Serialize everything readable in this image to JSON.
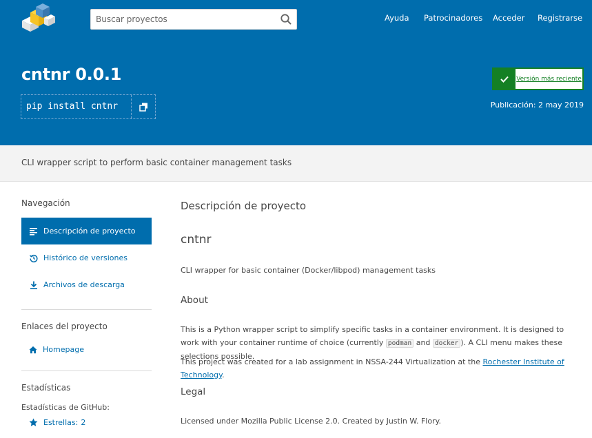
{
  "header": {
    "search_placeholder": "Buscar proyectos",
    "nav": [
      "Ayuda",
      "Patrocinadores",
      "Acceder",
      "Registrarse"
    ]
  },
  "hero": {
    "title": "cntnr 0.0.1",
    "pip_command": "pip install cntnr",
    "latest_version": "Versión más reciente",
    "published": "Publicación: 2 may 2019"
  },
  "summary": "CLI wrapper script to perform basic container management tasks",
  "sidebar": {
    "nav_heading": "Navegación",
    "nav_items": [
      "Descripción de proyecto",
      "Histórico de versiones",
      "Archivos de descarga"
    ],
    "links_heading": "Enlaces del proyecto",
    "homepage": "Homepage",
    "stats_heading": "Estadísticas",
    "github_label": "Estadísticas de GitHub:",
    "stars_label": "Estrellas:",
    "stars_count": "2"
  },
  "main": {
    "section_title": "Descripción de proyecto",
    "h1": "cntnr",
    "intro": "CLI wrapper for basic container (Docker/libpod) management tasks",
    "about_heading": "About",
    "about_p1_a": "This is a Python wrapper script to simplify specific tasks in a container environment. It is designed to work with your container runtime of choice (currently ",
    "code1": "podman",
    "about_p1_b": " and ",
    "code2": "docker",
    "about_p1_c": "). A CLI menu makes these selections possible.",
    "about_p2_a": "This project was created for a lab assignment in NSSA-244 Virtualization at the ",
    "about_p2_link": "Rochester Institute of Technology",
    "about_p2_b": ".",
    "legal_heading": "Legal",
    "legal_text": "Licensed under Mozilla Public License 2.0. Created by Justin W. Flory."
  },
  "colors": {
    "brand": "#006dad",
    "success": "#148024",
    "summary_bg": "#f3f3f3"
  }
}
